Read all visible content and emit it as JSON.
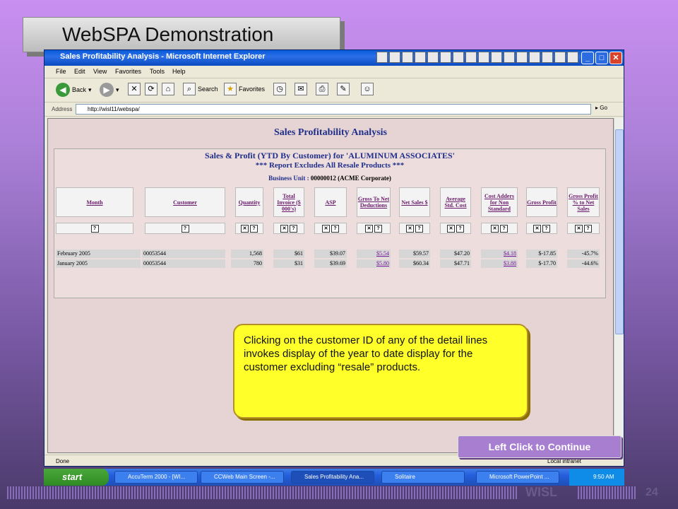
{
  "slide": {
    "title": "WebSPA Demonstration",
    "footer_brand": "WISL",
    "page_number": "24"
  },
  "window": {
    "title": "Sales Profitability Analysis - Microsoft Internet Explorer",
    "menu": [
      "File",
      "Edit",
      "View",
      "Favorites",
      "Tools",
      "Help"
    ],
    "toolbar": {
      "back": "Back",
      "search": "Search",
      "favorites": "Favorites"
    },
    "address_label": "Address",
    "address_value": "http://wisl11/webspa/",
    "go_label": "Go",
    "status_done": "Done",
    "status_zone": "Local intranet"
  },
  "page": {
    "heading": "Sales Profitability Analysis",
    "report_title": "Sales & Profit (YTD By Customer) for 'ALUMINUM ASSOCIATES'",
    "report_subtitle": "*** Report Excludes All Resale Products ***",
    "business_unit_label": "Business Unit :",
    "business_unit_value": "00000012 (ACME Corporate)",
    "columns": [
      "Month",
      "Customer",
      "Quantity",
      "Total Invoice ($ 000's)",
      "ASP",
      "Gross To Net Deductions",
      "Net Sales $",
      "Average Std. Cost",
      "Cost Adders for Non Standard",
      "Gross Profit",
      "Gross Profit % to Net Sales"
    ],
    "rows": [
      [
        "February 2005",
        "00053544",
        "1,568",
        "$61",
        "$39.07",
        "$5.54",
        "$59.57",
        "$47.20",
        "$4.18",
        "$-17.85",
        "-45.7%"
      ],
      [
        "January 2005",
        "00053544",
        "780",
        "$31",
        "$39.69",
        "$5.80",
        "$60.34",
        "$47.71",
        "$3.88",
        "$-17.70",
        "-44.6%"
      ]
    ]
  },
  "callout": "Clicking on the customer ID of any of the detail lines invokes display of the year to date display for the customer excluding “resale” products.",
  "continue_button": "Left Click to Continue",
  "taskbar": {
    "start": "start",
    "tasks": [
      "AccuTerm 2000 - [WI...",
      "CCWeb Main Screen -...",
      "Sales Profitability Ana...",
      "Solitaire",
      "Microsoft PowerPoint ..."
    ],
    "clock": "9:50 AM"
  }
}
